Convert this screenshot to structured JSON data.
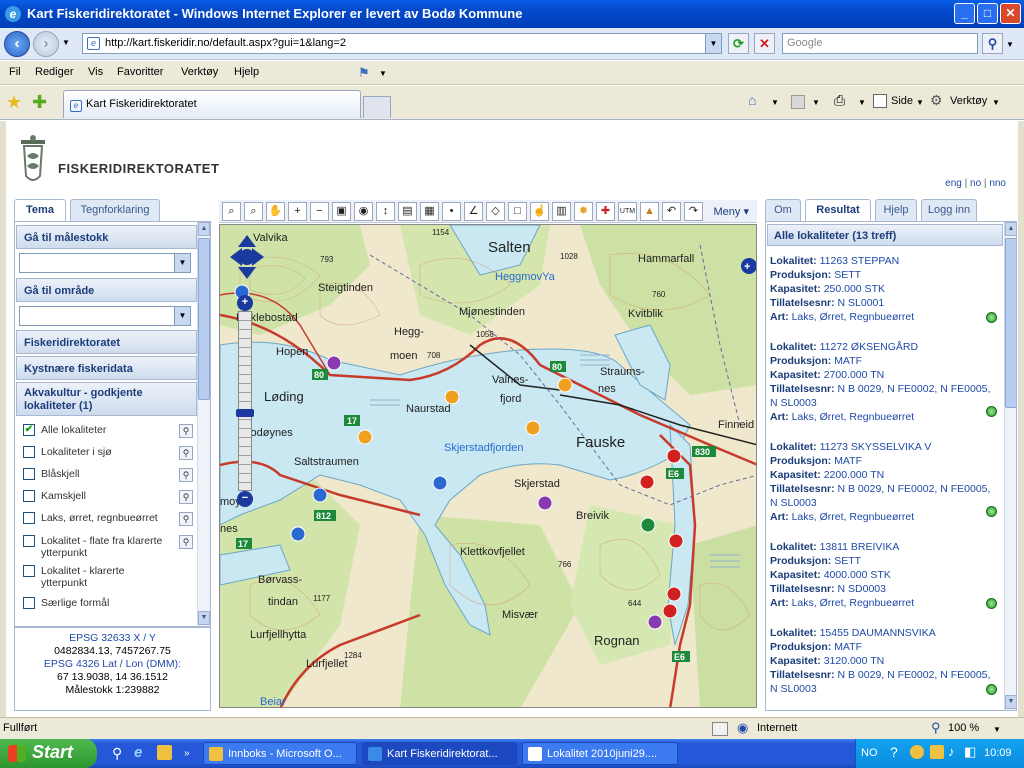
{
  "window": {
    "title": "Kart Fiskeridirektoratet - Windows Internet Explorer er levert av Bodø Kommune",
    "min": "_",
    "max": "□",
    "close": "✕"
  },
  "address": {
    "url": "http://kart.fiskeridir.no/default.aspx?gui=1&lang=2",
    "search_placeholder": "Google"
  },
  "menu": [
    "Fil",
    "Rediger",
    "Vis",
    "Favoritter",
    "Verktøy",
    "Hjelp"
  ],
  "tab": {
    "label": "Kart Fiskeridirektoratet"
  },
  "tools": {
    "side": "Side",
    "verktoy": "Verktøy"
  },
  "site": {
    "logo_text": "FISKERIDIREKTORATET",
    "lang": [
      "eng",
      "no",
      "nno"
    ]
  },
  "left": {
    "tabs": [
      "Tema",
      "Tegnforklaring"
    ],
    "sections": {
      "scale": "Gå til målestokk",
      "area": "Gå til område",
      "fd": "Fiskeridirektoratet",
      "kyst": "Kystnære fiskeridata",
      "akva": "Akvakultur - godkjente lokaliteter (1)"
    },
    "items": [
      {
        "label": "Alle lokaliteter",
        "checked": true
      },
      {
        "label": "Lokaliteter i sjø",
        "checked": false
      },
      {
        "label": "Blåskjell",
        "checked": false
      },
      {
        "label": "Kamskjell",
        "checked": false
      },
      {
        "label": "Laks, ørret, regnbueørret",
        "checked": false
      },
      {
        "label": "Lokalitet - flate fra klarerte ytterpunkt",
        "checked": false
      },
      {
        "label": "Lokalitet - klarerte ytterpunkt",
        "checked": false
      },
      {
        "label": "Særlige formål",
        "checked": false
      }
    ]
  },
  "coords": {
    "epsg1": "EPSG 32633 X / Y",
    "xy": "0482834.13, 7457267.75",
    "epsg2": "EPSG 4326 Lat / Lon (DMM):",
    "latlon": "67 13.9038, 14 36.1512",
    "scale": "Målestokk 1:239882"
  },
  "toolbar": {
    "menu": "Meny"
  },
  "map_labels": [
    "Valvika",
    "793",
    "Steigtinden",
    "Salten",
    "1028",
    "Hammarfall",
    "HeggmovYa",
    "Mjønestinden",
    "760",
    "Kvitblik",
    "Myklebostad",
    "Hopen",
    "Hegg-",
    "moen",
    "708",
    "1058",
    "Straums-",
    "nes",
    "Valnes-",
    "fjord",
    "Løding",
    "Naurstad",
    "Finneid",
    "Godøynes",
    "Skjerstadfjorden",
    "Fauske",
    "Saltstraumen",
    "Skjerstad",
    "Breivik",
    "nes",
    "Klettkovfjellet",
    "766",
    "Børvass-",
    "tindan",
    "1177",
    "Misvær",
    "644",
    "Lurfjellhytta",
    "Lurfjellet",
    "1284",
    "Rognan",
    "Beiar",
    "1154",
    "moya"
  ],
  "right": {
    "tabs": [
      "Om",
      "Resultat",
      "Hjelp",
      "Logg inn"
    ],
    "header": "Alle lokaliteter (13 treff)",
    "entries": [
      {
        "lok": "11263 STEPPAN",
        "prod": "SETT",
        "kap": "250.000 STK",
        "till": "N SL0001",
        "art": "Laks, Ørret, Regnbueørret"
      },
      {
        "lok": "11272 ØKSENGÅRD",
        "prod": "MATF",
        "kap": "2700.000 TN",
        "till": "N B 0029, N FE0002, N FE0005, N SL0003",
        "art": "Laks, Ørret, Regnbueørret"
      },
      {
        "lok": "11273 SKYSSELVIKA V",
        "prod": "MATF",
        "kap": "2200.000 TN",
        "till": "N B 0029, N FE0002, N FE0005, N SL0003",
        "art": "Laks, Ørret, Regnbueørret"
      },
      {
        "lok": "13811 BREIVIKA",
        "prod": "SETT",
        "kap": "4000.000 STK",
        "till": "N SD0003",
        "art": "Laks, Ørret, Regnbueørret"
      },
      {
        "lok": "15455 DAUMANNSVIKA",
        "prod": "MATF",
        "kap": "3120.000 TN",
        "till": "N B 0029, N FE0002, N FE0005, N SL0003",
        "art": ""
      }
    ],
    "labels": {
      "lok": "Lokalitet:",
      "prod": "Produksjon:",
      "kap": "Kapasitet:",
      "till": "Tillatelsesnr:",
      "art": "Art:"
    }
  },
  "status": {
    "done": "Fullført",
    "zone": "Internett",
    "zoom": "100 %"
  },
  "taskbar": {
    "start": "Start",
    "tasks": [
      "Innboks - Microsoft O...",
      "Kart Fiskeridirektorat...",
      "Lokalitet 2010juni29...."
    ],
    "lang": "NO",
    "time": "10:09"
  }
}
